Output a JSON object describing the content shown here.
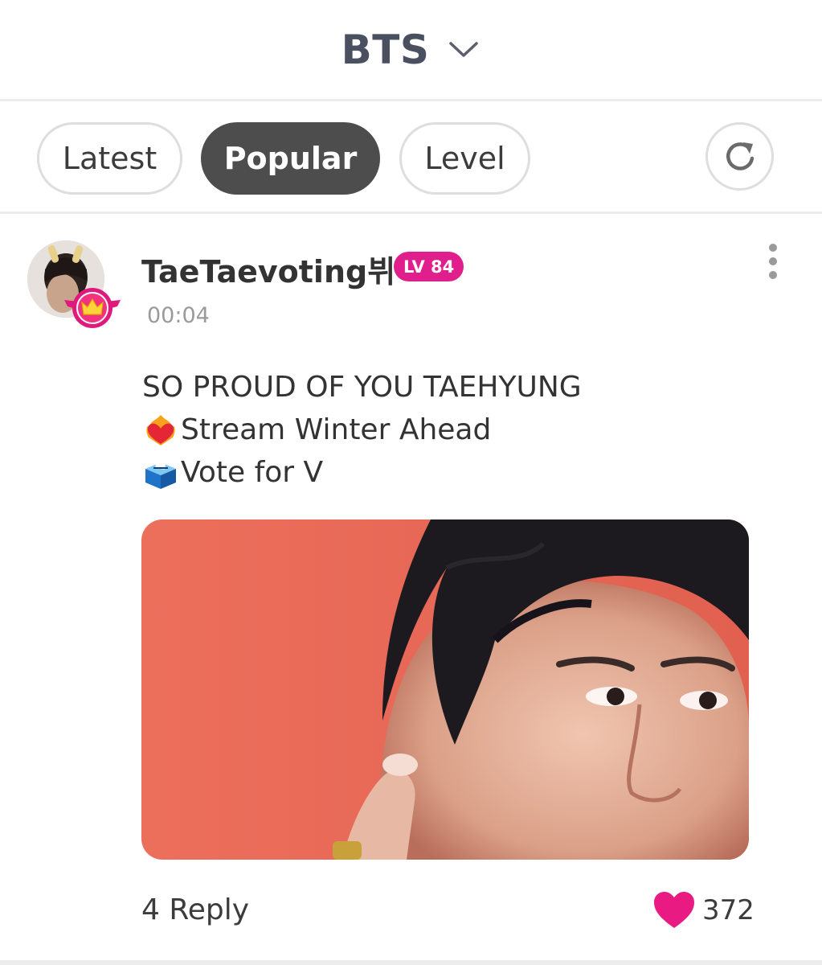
{
  "header": {
    "title": "BTS",
    "dropdown_icon": "chevron-down-icon"
  },
  "tabs": [
    {
      "label": "Latest",
      "active": false
    },
    {
      "label": "Popular",
      "active": true
    },
    {
      "label": "Level",
      "active": false
    }
  ],
  "refresh_icon": "refresh-icon",
  "post": {
    "username": "TaeTaevoting뷔",
    "level": "LV 84",
    "time": "00:04",
    "lines": [
      {
        "emoji": "heart-on-fire-emoji",
        "text": "SO PROUD OF YOU TAEHYUNG"
      },
      {
        "emoji": "heart-on-fire-emoji",
        "text": "Stream Winter Ahead"
      },
      {
        "emoji": "ballot-box-emoji",
        "text": "Vote for V"
      }
    ],
    "reply_label": "4 Reply",
    "like_count": "372",
    "like_icon": "heart-icon"
  },
  "colors": {
    "accent": "#e01f8c",
    "active_tab": "#4d4d4d",
    "title": "#4a5060",
    "muted": "#9a9a9a"
  }
}
